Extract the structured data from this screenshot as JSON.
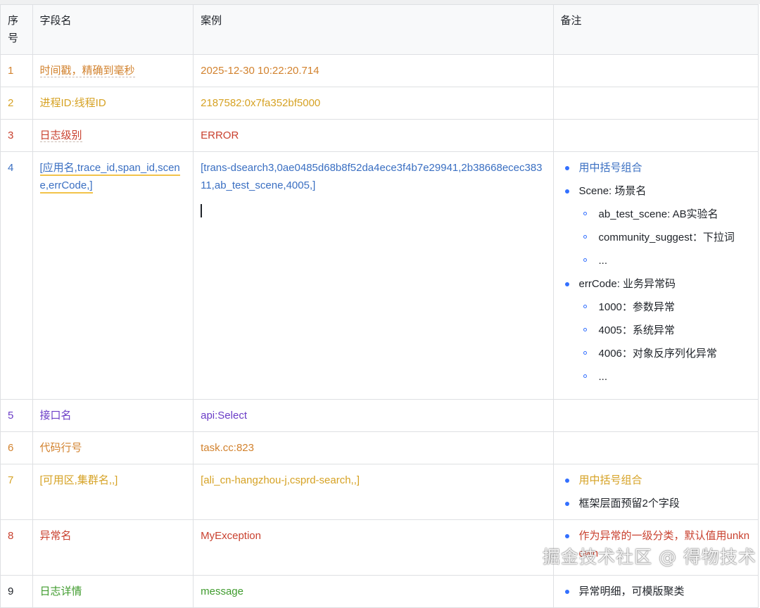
{
  "table": {
    "headers": [
      "序号",
      "字段名",
      "案例",
      "备注"
    ],
    "rows": [
      {
        "no": "1",
        "field": "时间戳，精确到毫秒",
        "example": "2025-12-30 10:22:20.714"
      },
      {
        "no": "2",
        "field": "进程ID:线程ID",
        "example": "2187582:0x7fa352bf5000"
      },
      {
        "no": "3",
        "field": "日志级别",
        "example": "ERROR"
      },
      {
        "no": "4",
        "field": "[应用名,trace_id,span_id,scene,errCode,]",
        "example": "[trans-dsearch3,0ae0485d68b8f52da4ece3f4b7e29941,2b38668ecec38311,ab_test_scene,4005,]",
        "notes": {
          "item1": "用中括号组合",
          "item2": "Scene: 场景名",
          "item2_sub": [
            "ab_test_scene: AB实验名",
            "community_suggest：下拉词",
            "..."
          ],
          "item3": "errCode: 业务异常码",
          "item3_sub": [
            "1000：参数异常",
            "4005：系统异常",
            "4006：对象反序列化异常",
            "..."
          ]
        }
      },
      {
        "no": "5",
        "field": "接口名",
        "example": "api:Select"
      },
      {
        "no": "6",
        "field": "代码行号",
        "example": "task.cc:823"
      },
      {
        "no": "7",
        "field": "[可用区,集群名,,]",
        "example": "[ali_cn-hangzhou-j,csprd-search,,]",
        "notes": {
          "item1": "用中括号组合",
          "item2": "框架层面预留2个字段"
        }
      },
      {
        "no": "8",
        "field": "异常名",
        "example": "MyException",
        "notes": {
          "item1": "作为异常的一级分类，默认值用unknown"
        }
      },
      {
        "no": "9",
        "field": "日志详情",
        "example": "message",
        "notes": {
          "item1": "异常明细，可模版聚类"
        }
      }
    ]
  },
  "watermark": "掘金技术社区 @ 得物技术",
  "colors": {
    "orange": "#d2822e",
    "gold": "#d6a224",
    "red": "#c9412f",
    "blue": "#3a6fc2",
    "purple": "#6b3dc7",
    "green": "#3f9b2d",
    "bullet": "#3370ff"
  }
}
